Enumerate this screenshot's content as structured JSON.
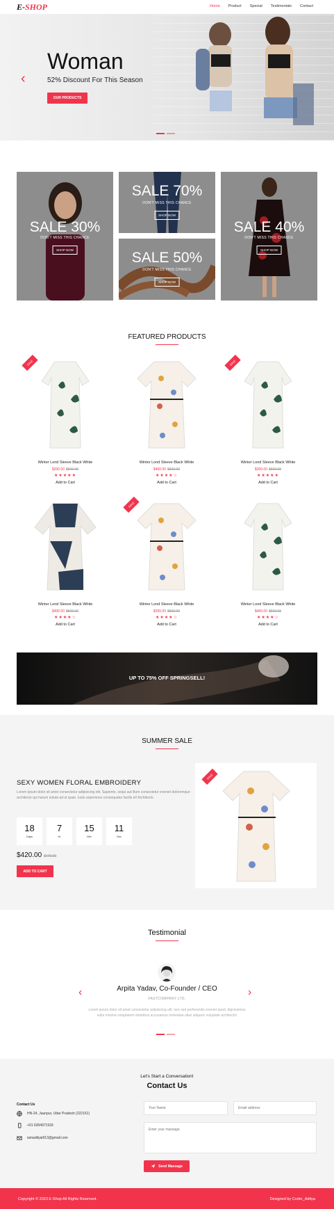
{
  "nav": {
    "logo_main": "E-",
    "logo_accent": "SHOP",
    "items": [
      "Home",
      "Product",
      "Special",
      "Testimonials",
      "Contact"
    ]
  },
  "hero": {
    "title": "Woman",
    "subtitle": "52% Discount For This Season",
    "button": "OUR PRODUCTS"
  },
  "categories": [
    {
      "sale": "SALE 30%",
      "tagline": "DON'T MISS THIS CHANCE",
      "button": "SHOP NOW"
    },
    {
      "sale": "SALE 70%",
      "tagline": "DON'T MISS THIS CHANCE",
      "button": "SHOP NOW"
    },
    {
      "sale": "SALE 50%",
      "tagline": "DON'T MISS THIS CHANCE",
      "button": "SHOP NOW"
    },
    {
      "sale": "SALE 40%",
      "tagline": "DON'T MISS THIS CHANCE",
      "button": "SHOP NOW"
    }
  ],
  "featured": {
    "title": "FEATURED PRODUCTS",
    "products": [
      {
        "name": "Winter Lond Sleeve Black White",
        "price": "$200.00",
        "old_price": "$500.00",
        "stars": "★★★★★",
        "cart": "Add to Cart",
        "badge": "SALE"
      },
      {
        "name": "Winter Lond Sleeve Black White",
        "price": "$400.00",
        "old_price": "$500.00",
        "stars": "★★★★☆",
        "cart": "Add to Cart",
        "badge": ""
      },
      {
        "name": "Winter Lond Sleeve Black White",
        "price": "$200.00",
        "old_price": "$500.00",
        "stars": "★★★★★",
        "cart": "Add to Cart",
        "badge": "SALE"
      },
      {
        "name": "Winter Lond Sleeve Black White",
        "price": "$400.00",
        "old_price": "$500.00",
        "stars": "★★★★☆",
        "cart": "Add to Cart",
        "badge": ""
      },
      {
        "name": "Winter Lond Sleeve Black White",
        "price": "$200.00",
        "old_price": "$500.00",
        "stars": "★★★★☆",
        "cart": "Add to Cart",
        "badge": "SALE"
      },
      {
        "name": "Winter Lond Sleeve Black White",
        "price": "$400.00",
        "old_price": "$500.00",
        "stars": "★★★★☆",
        "cart": "Add to Cart",
        "badge": ""
      }
    ]
  },
  "banner": {
    "text": "UP TO 75% OFF SPRINGSELL!"
  },
  "summer": {
    "section_title": "SUMMER SALE",
    "heading": "SEXY WOMEN FLORAL EMBROIDERY",
    "text": "Lorem ipsum dolor sit amet consectetur adipisicing elit. Sapiente, sequi aut illum consectetur eveniet doloremque architecto qui harum soluta ad ut quae. Iusto asperiores consequatur facilis et! Architecto.",
    "countdown": [
      {
        "value": "18",
        "label": "Days"
      },
      {
        "value": "7",
        "label": "Hr"
      },
      {
        "value": "15",
        "label": "Min"
      },
      {
        "value": "11",
        "label": "Sec"
      }
    ],
    "price": "$420.00",
    "old_price": "$470.00",
    "button": "ADD TO CART",
    "badge": "SALE"
  },
  "testimonial": {
    "title": "Testimonial",
    "name": "Arpita Yadav, Co-Founder / CEO",
    "company": "FASTCOMPANY LTD.",
    "quote": "Lorem ipsum dolor sit amet consectetur adipisicing elit. Iure sed perferendis eveniet quod, dignissimos nulla minima voluptatem doloribus accusamus molestiae alias aliquam voluptate architecto!"
  },
  "contact": {
    "kicker": "Let's Start a Conversation!",
    "title": "Contact Us",
    "info_heading": "Contact Us",
    "address": "HN-24, Jaunpur, Uttar Pradesh (222161)",
    "phone": "+91 6394971918",
    "email": "iamadityai913@gmail.com",
    "name_placeholder": "Your Name",
    "email_placeholder": "Email address",
    "message_placeholder": "Enter your massage",
    "send": "Send Massage"
  },
  "footer": {
    "copyright": "Copyright © 2023 E-Shop All Rights Reserved.",
    "credit": "Designed by Coder_Aditya"
  },
  "colors": {
    "accent": "#f1344c",
    "dark": "#111111",
    "light_bg": "#f4f4f4"
  }
}
